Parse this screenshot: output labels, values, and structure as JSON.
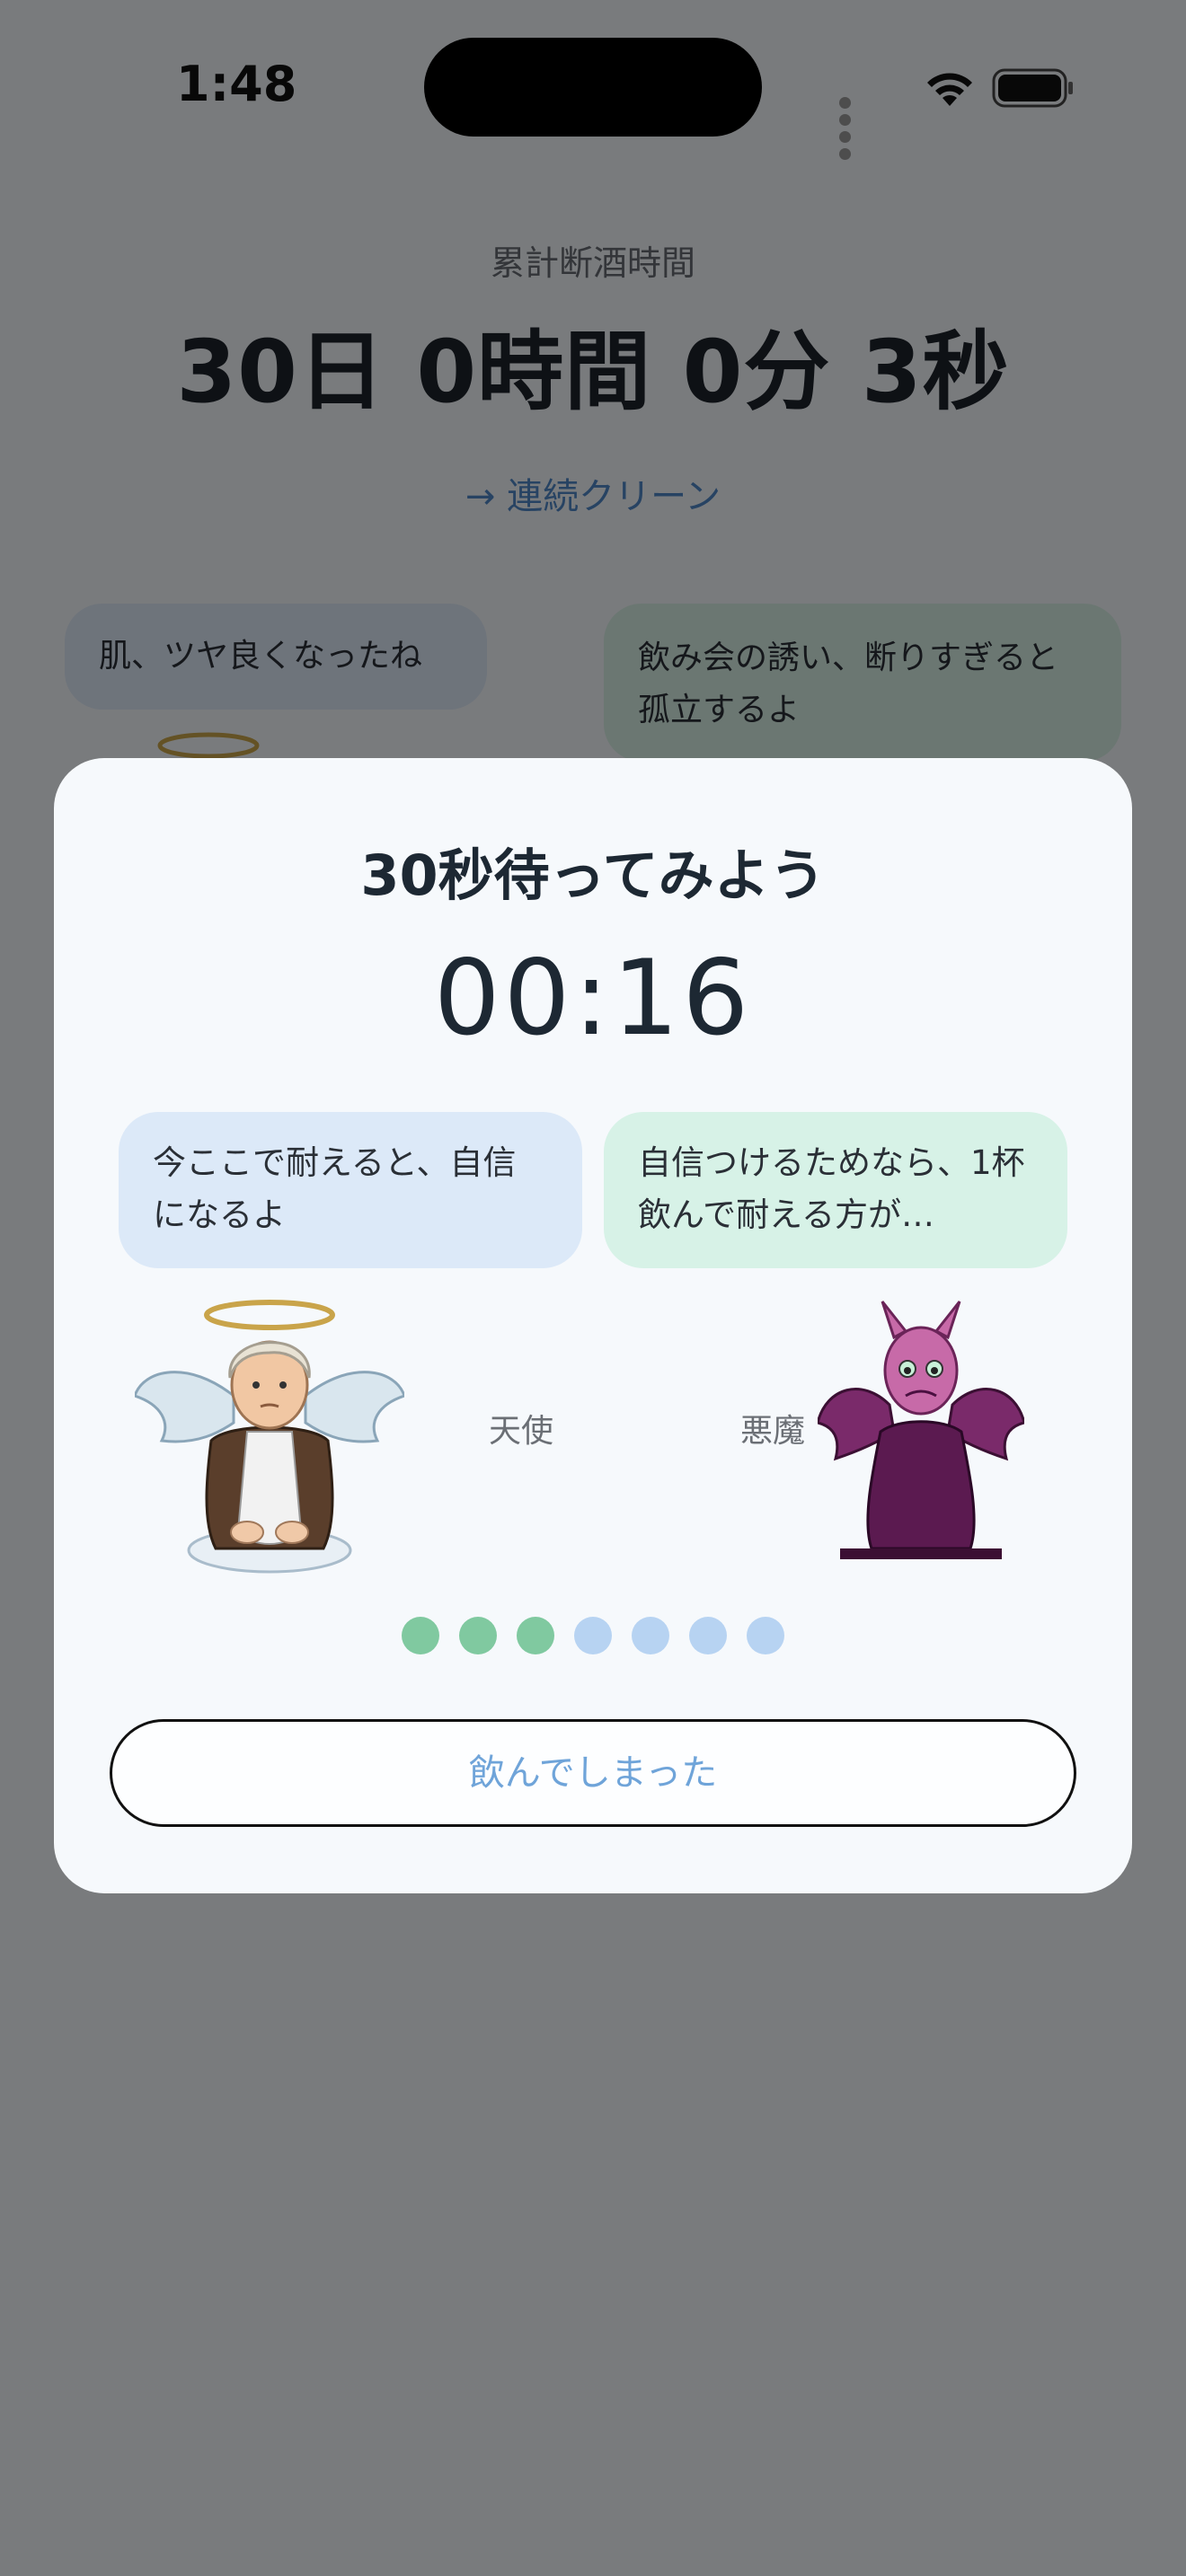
{
  "status_bar": {
    "time": "1:48"
  },
  "background": {
    "cumulative_label": "累計断酒時間",
    "cumulative_value": "30日 0時間 0分 3秒",
    "streak_link": "→ 連続クリーン",
    "angel_bubble": "肌、ツヤ良くなったね",
    "devil_bubble": "飲み会の誘い、断りすぎると孤立するよ"
  },
  "modal": {
    "title": "30秒待ってみよう",
    "timer": "00:16",
    "angel_message": "今ここで耐えると、自信になるよ",
    "devil_message": "自信つけるためなら、1杯飲んで耐える方が…",
    "angel_label": "天使",
    "devil_label": "悪魔",
    "progress": {
      "completed": 3,
      "total": 7
    },
    "drank_button": "飲んでしまった"
  },
  "colors": {
    "accent_blue": "#6fa4d9",
    "link_blue": "#4f86c6",
    "dot_done": "#80c9a0",
    "dot_pending": "#b7d3f2",
    "angel_bubble": "#dce9f8",
    "devil_bubble": "#d7f2e7"
  },
  "icons": [
    "wifi-icon",
    "battery-icon",
    "cellular-signal-icon",
    "arrow-right-icon"
  ]
}
